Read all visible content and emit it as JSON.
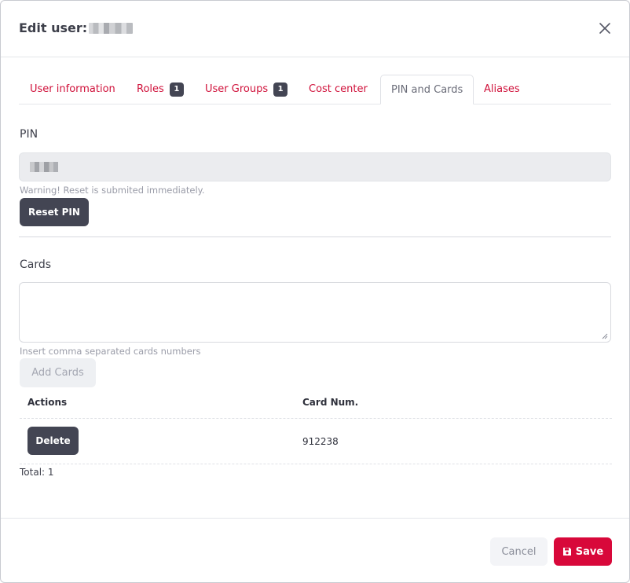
{
  "dialog": {
    "title": "Edit user:",
    "close_icon": "close-icon"
  },
  "tabs": [
    {
      "label": "User information"
    },
    {
      "label": "Roles",
      "badge": "1"
    },
    {
      "label": "User Groups",
      "badge": "1"
    },
    {
      "label": "Cost center"
    },
    {
      "label": "PIN and Cards",
      "active": true
    },
    {
      "label": "Aliases"
    }
  ],
  "pin": {
    "title": "PIN",
    "warning": "Warning! Reset is submited immediately.",
    "reset_label": "Reset PIN"
  },
  "cards": {
    "title": "Cards",
    "hint": "Insert comma separated cards numbers",
    "add_label": "Add Cards",
    "table": {
      "headers": [
        "Actions",
        "Card Num."
      ],
      "rows": [
        {
          "action_label": "Delete",
          "card_number": "912238"
        }
      ]
    },
    "total": "Total: 1"
  },
  "footer": {
    "cancel_label": "Cancel",
    "save_label": "Save",
    "save_icon": "floppy-disk-icon"
  },
  "colors": {
    "accent": "#d8083a",
    "tab_link": "#d0123b",
    "dark_button": "#434553"
  }
}
